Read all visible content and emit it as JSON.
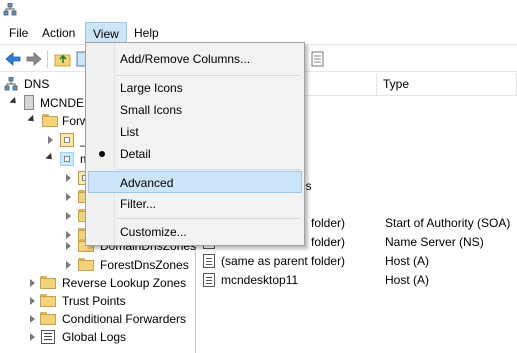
{
  "menubar": {
    "items": [
      "File",
      "Action",
      "View",
      "Help"
    ]
  },
  "view_menu": {
    "items": [
      {
        "label": "Add/Remove Columns..."
      },
      {
        "label": "Large Icons"
      },
      {
        "label": "Small Icons"
      },
      {
        "label": "List"
      },
      {
        "label": "Detail",
        "checked": true
      },
      {
        "label": "Advanced",
        "highlighted": true
      },
      {
        "label": "Filter..."
      },
      {
        "label": "Customize..."
      }
    ]
  },
  "tree": {
    "root": "DNS",
    "server": "MCNDE",
    "forward": "Forw",
    "zone_sub1": "_",
    "zone_selected": "m",
    "domain_dns_zones": "DomainDnsZones",
    "forest_dns_zones": "ForestDnsZones",
    "reverse_lookup": "Reverse Lookup Zones",
    "trust_points": "Trust Points",
    "conditional_forwarders": "Conditional Forwarders",
    "global_logs": "Global Logs"
  },
  "details": {
    "col_type": "Type",
    "partial_text": "es",
    "records": [
      {
        "name": "folder)",
        "type": "Start of Authority (SOA)"
      },
      {
        "name": "folder)",
        "type": "Name Server (NS)"
      },
      {
        "name": "(same as parent folder)",
        "type": "Host (A)"
      },
      {
        "name": "mcndesktop11",
        "type": "Host (A)"
      }
    ]
  },
  "colors": {
    "highlight": "#cce4f7",
    "highlight_border": "#99c9ef",
    "menu_bg": "#f2f2f2"
  }
}
